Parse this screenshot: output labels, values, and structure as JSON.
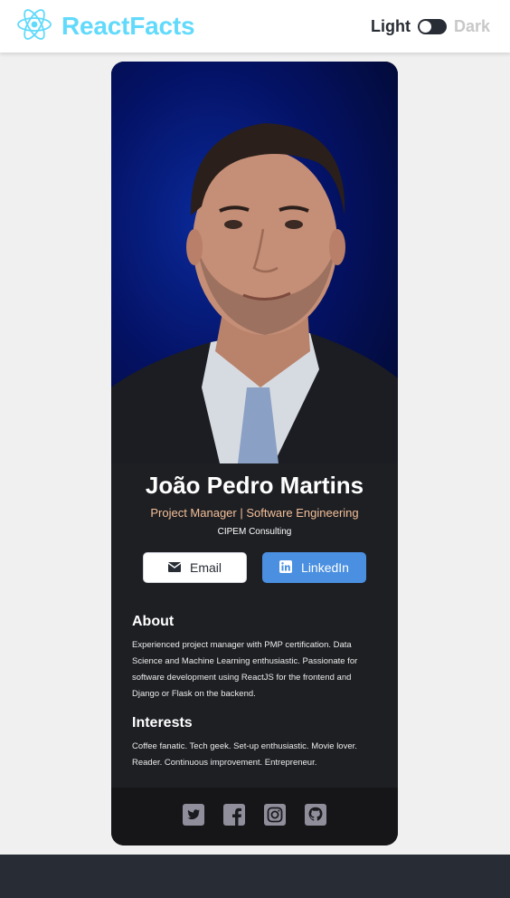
{
  "header": {
    "brand": "ReactFacts",
    "toggle_light": "Light",
    "toggle_dark": "Dark"
  },
  "profile": {
    "name": "João Pedro Martins",
    "role": "Project Manager | Software Engineering",
    "company": "CIPEM Consulting",
    "email_label": "Email",
    "linkedin_label": "LinkedIn",
    "about_heading": "About",
    "about_text": "Experienced project manager with PMP certification. Data Science and Machine Learning enthusiastic. Passionate for software development using ReactJS for the frontend and Django or Flask on the backend.",
    "interests_heading": "Interests",
    "interests_text": "Coffee fanatic. Tech geek. Set-up enthusiastic. Movie lover. Reader. Continuous improvement. Entrepreneur."
  },
  "social_icons": [
    "twitter-icon",
    "facebook-icon",
    "instagram-icon",
    "github-icon"
  ],
  "colors": {
    "brand": "#61dafb",
    "role": "#f3bf99",
    "linkedin": "#4a8fe0",
    "card": "#1a1b1e",
    "footer": "#282c34"
  }
}
